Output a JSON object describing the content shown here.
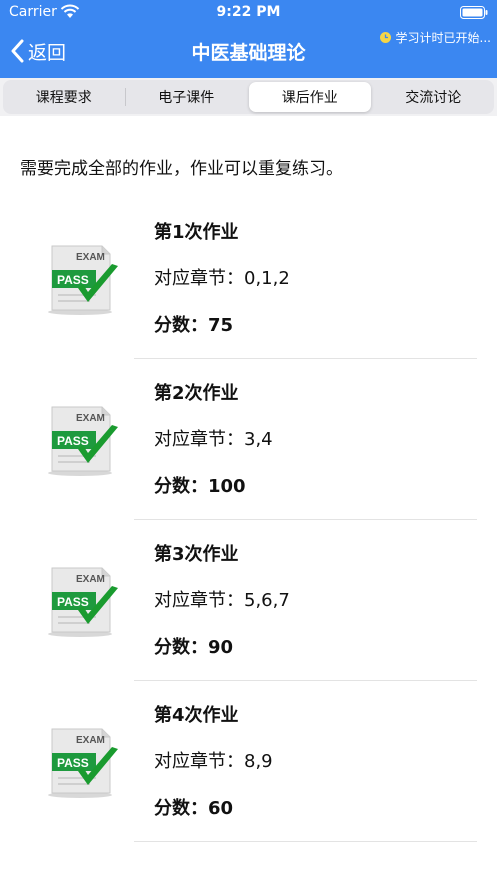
{
  "status_bar": {
    "carrier": "Carrier",
    "time": "9:22 PM"
  },
  "nav": {
    "back_label": "返回",
    "title": "中医基础理论",
    "timer_text": "学习计时已开始..."
  },
  "tabs": [
    {
      "label": "课程要求",
      "active": false
    },
    {
      "label": "电子课件",
      "active": false
    },
    {
      "label": "课后作业",
      "active": true
    },
    {
      "label": "交流讨论",
      "active": false
    }
  ],
  "intro": "需要完成全部的作业，作业可以重复练习。",
  "exam_icon": {
    "top_text": "EXAM",
    "badge_text": "PASS"
  },
  "assignments": [
    {
      "title": "第1次作业",
      "chapter_prefix": "对应章节：",
      "chapters": "0,1,2",
      "score_prefix": "分数：",
      "score": "75"
    },
    {
      "title": "第2次作业",
      "chapter_prefix": "对应章节：",
      "chapters": "3,4",
      "score_prefix": "分数：",
      "score": "100"
    },
    {
      "title": "第3次作业",
      "chapter_prefix": "对应章节：",
      "chapters": "5,6,7",
      "score_prefix": "分数：",
      "score": "90"
    },
    {
      "title": "第4次作业",
      "chapter_prefix": "对应章节：",
      "chapters": "8,9",
      "score_prefix": "分数：",
      "score": "60"
    }
  ],
  "colors": {
    "header_blue": "#3b87f1",
    "pass_green": "#1e9a3e",
    "check_green": "#1a9b2f"
  }
}
